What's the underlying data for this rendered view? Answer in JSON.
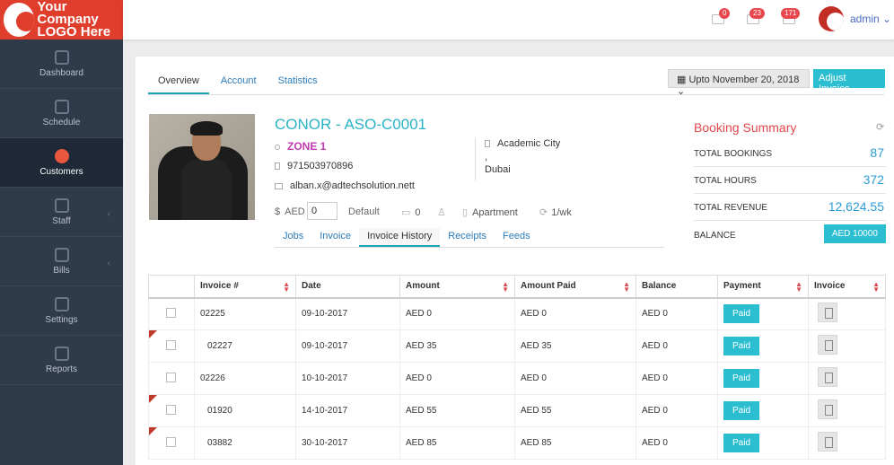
{
  "logo": {
    "line1": "Your Company",
    "line2": "LOGO Here"
  },
  "topbar": {
    "badges": [
      "0",
      "23",
      "171"
    ],
    "user": "admin ⌄"
  },
  "sidebar": {
    "items": [
      {
        "label": "Dashboard",
        "icon": "home-icon"
      },
      {
        "label": "Schedule",
        "icon": "calendar-icon"
      },
      {
        "label": "Customers",
        "icon": "users-icon"
      },
      {
        "label": "Staff",
        "icon": "user-icon"
      },
      {
        "label": "Bills",
        "icon": "bill-icon"
      },
      {
        "label": "Settings",
        "icon": "wrench-icon"
      },
      {
        "label": "Reports",
        "icon": "chart-icon"
      }
    ]
  },
  "tabs": [
    "Overview",
    "Account",
    "Statistics"
  ],
  "date_filter": "Upto November 20, 2018 ⌄",
  "adjust_invoice": "Adjust Invoice",
  "customer": {
    "name": "CONOR - ASO-C0001",
    "zone": "ZONE 1",
    "phone": "971503970896",
    "email": "alban.x@adtechsolution.nett",
    "location": "Academic City",
    "location_sep": ",",
    "city": "Dubai",
    "currency": "AED",
    "amount": "0",
    "default": "Default",
    "beds": "0",
    "type": "Apartment",
    "frequency": "1/wk"
  },
  "subtabs": [
    "Jobs",
    "Invoice",
    "Invoice History",
    "Receipts",
    "Feeds"
  ],
  "booking_summary": {
    "title": "Booking Summary",
    "rows": [
      {
        "label": "TOTAL BOOKINGS",
        "value": "87"
      },
      {
        "label": "TOTAL HOURS",
        "value": "372"
      },
      {
        "label": "TOTAL REVENUE",
        "value": "12,624.55"
      },
      {
        "label": "BALANCE",
        "value": "AED 10000"
      }
    ]
  },
  "table": {
    "headers": [
      "Invoice #",
      "Date",
      "Amount",
      "Amount Paid",
      "Balance",
      "Payment",
      "Invoice"
    ],
    "rows": [
      {
        "invoice": "02225",
        "date": "09-10-2017",
        "amount": "AED 0",
        "paid": "AED 0",
        "balance": "AED 0",
        "payment": "Paid",
        "flag": false
      },
      {
        "invoice": "02227",
        "date": "09-10-2017",
        "amount": "AED 35",
        "paid": "AED 35",
        "balance": "AED 0",
        "payment": "Paid",
        "flag": true
      },
      {
        "invoice": "02226",
        "date": "10-10-2017",
        "amount": "AED 0",
        "paid": "AED 0",
        "balance": "AED 0",
        "payment": "Paid",
        "flag": false
      },
      {
        "invoice": "01920",
        "date": "14-10-2017",
        "amount": "AED 55",
        "paid": "AED 55",
        "balance": "AED 0",
        "payment": "Paid",
        "flag": true
      },
      {
        "invoice": "03882",
        "date": "30-10-2017",
        "amount": "AED 85",
        "paid": "AED 85",
        "balance": "AED 0",
        "payment": "Paid",
        "flag": true
      }
    ]
  }
}
